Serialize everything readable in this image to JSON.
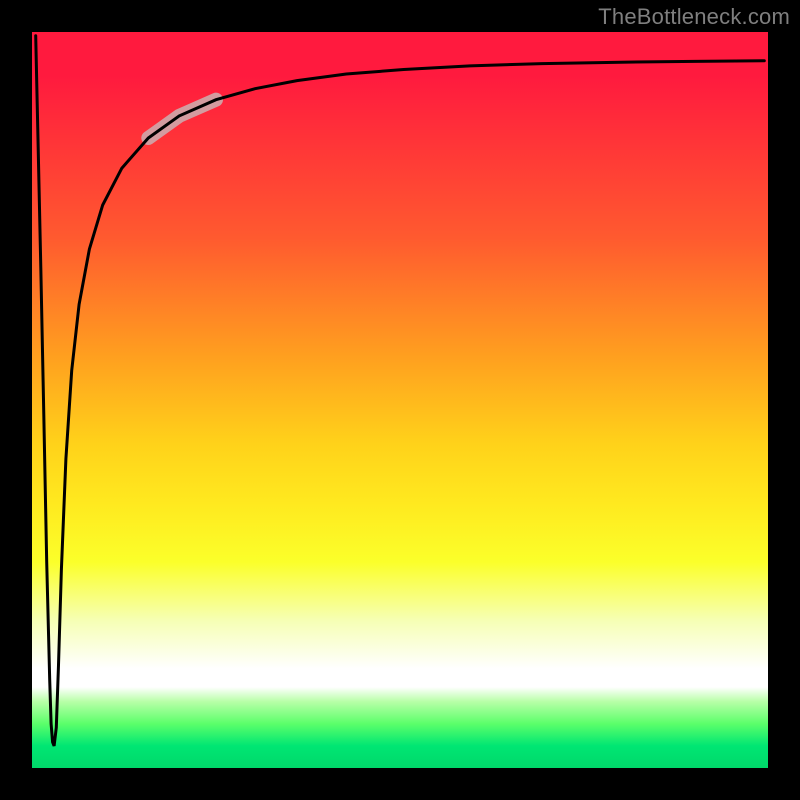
{
  "watermark": "TheBottleneck.com",
  "chart_data": {
    "type": "line",
    "title": "",
    "xlabel": "",
    "ylabel": "",
    "xlim": [
      0,
      100
    ],
    "ylim": [
      0,
      100
    ],
    "grid": false,
    "legend": false,
    "annotations": [],
    "series": [
      {
        "name": "curve",
        "color": "#000000",
        "x": [
          0.5,
          0.8,
          1.2,
          1.6,
          2.0,
          2.4,
          2.6,
          2.8,
          3.0,
          3.3,
          3.6,
          4.0,
          4.6,
          5.4,
          6.4,
          7.8,
          9.6,
          12.2,
          15.8,
          20.0,
          25.0,
          30.3,
          36.0,
          42.7,
          50.5,
          59.5,
          69.3,
          80.0,
          90.0,
          99.5
        ],
        "y": [
          99.5,
          86.0,
          68.0,
          48.0,
          28.0,
          12.0,
          6.0,
          3.5,
          3.0,
          5.5,
          14.0,
          27.0,
          42.0,
          54.0,
          63.0,
          70.5,
          76.5,
          81.5,
          85.6,
          88.6,
          90.8,
          92.3,
          93.4,
          94.3,
          94.9,
          95.4,
          95.7,
          95.9,
          96.0,
          96.1
        ]
      }
    ],
    "highlight_region": {
      "series": "curve",
      "x_range": [
        15.8,
        25.0
      ],
      "color": "#d39ca0"
    }
  }
}
